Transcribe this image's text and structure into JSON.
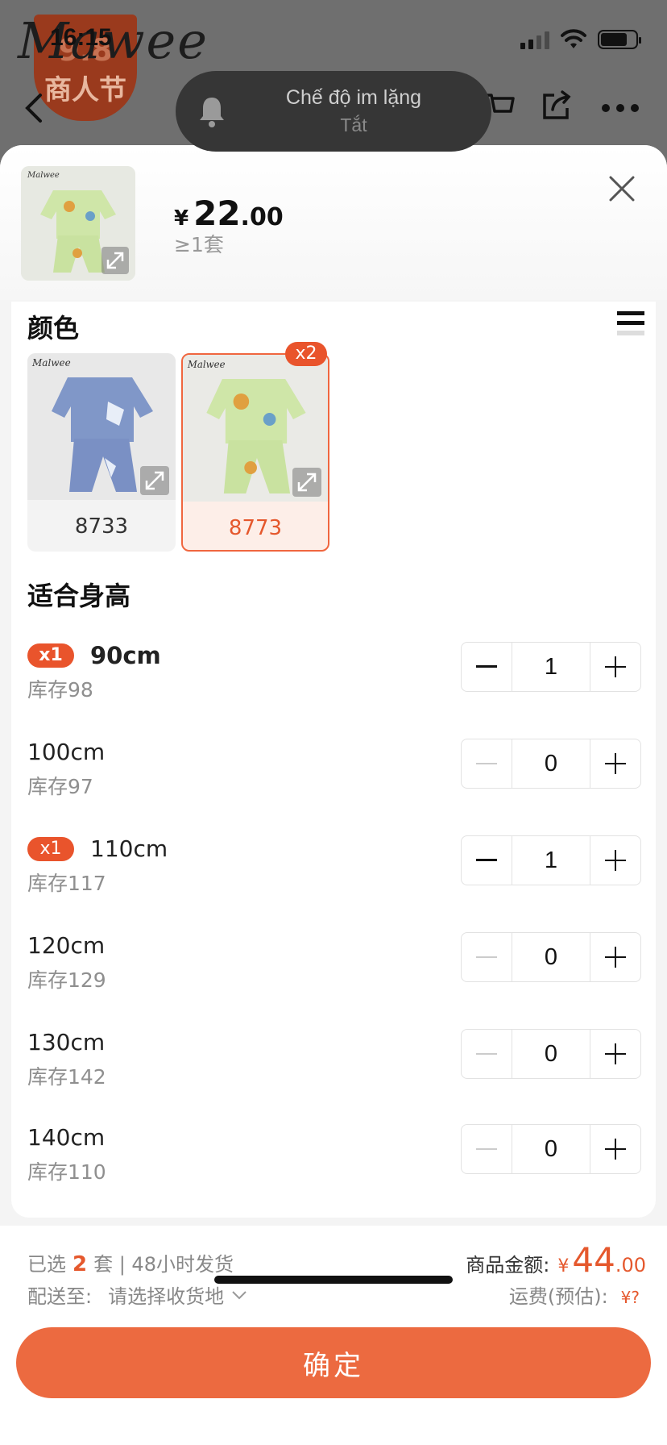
{
  "status_bar": {
    "time": "16:15"
  },
  "background_page": {
    "brand": "Mawee",
    "promo_line1": "9.8",
    "promo_line2": "商人节"
  },
  "toast": {
    "title": "Chế độ im lặng",
    "subtitle": "Tắt"
  },
  "product": {
    "currency": "¥",
    "price_int": "22",
    "price_dec": ".00",
    "moq": "≥1套"
  },
  "color_section": {
    "title": "颜色",
    "options": [
      {
        "name": "8733",
        "selected": false,
        "badge": ""
      },
      {
        "name": "8773",
        "selected": true,
        "badge": "x2"
      }
    ]
  },
  "size_section": {
    "title": "适合身高",
    "rows": [
      {
        "size": "90cm",
        "stock": "库存98",
        "qty": "1",
        "badge": "x1"
      },
      {
        "size": "100cm",
        "stock": "库存97",
        "qty": "0",
        "badge": ""
      },
      {
        "size": "110cm",
        "stock": "库存117",
        "qty": "1",
        "badge": "x1"
      },
      {
        "size": "120cm",
        "stock": "库存129",
        "qty": "0",
        "badge": ""
      },
      {
        "size": "130cm",
        "stock": "库存142",
        "qty": "0",
        "badge": ""
      },
      {
        "size": "140cm",
        "stock": "库存110",
        "qty": "0",
        "badge": ""
      }
    ]
  },
  "footer": {
    "selected_prefix": "已选",
    "selected_count": "2",
    "selected_suffix": "套 | 48小时发货",
    "ship_label": "配送至:",
    "ship_value": "请选择收货地",
    "amount_label": "商品金额:",
    "amount_currency": "¥",
    "amount_int": "44",
    "amount_dec": ".00",
    "freight_label": "运费(预估):",
    "freight_value": "¥?",
    "confirm_label": "确定"
  },
  "colors": {
    "accent": "#ec6a40",
    "accent_text": "#e5582d",
    "badge": "#e9542c"
  }
}
